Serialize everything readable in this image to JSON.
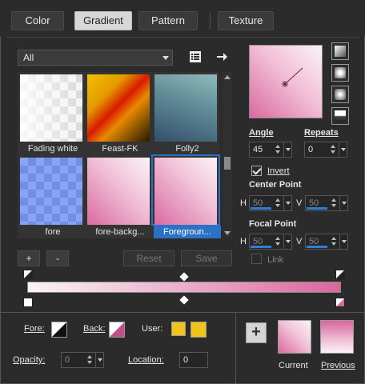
{
  "tabs": [
    {
      "label": "Color",
      "active": false
    },
    {
      "label": "Gradient",
      "active": true
    },
    {
      "label": "Pattern",
      "active": false
    },
    {
      "label": "Texture",
      "active": false
    }
  ],
  "category_select": {
    "value": "All"
  },
  "library": {
    "items": [
      {
        "label": "Fading white",
        "selected": false
      },
      {
        "label": "Feast-FK",
        "selected": false
      },
      {
        "label": "Folly2",
        "selected": false
      },
      {
        "label": "fore",
        "selected": false
      },
      {
        "label": "fore-backg...",
        "selected": false
      },
      {
        "label": "Foregroun...",
        "selected": true
      }
    ]
  },
  "buttons": {
    "add": "+",
    "remove": "-",
    "reset": "Reset",
    "save": "Save"
  },
  "angle": {
    "label": "Angle",
    "value": "45"
  },
  "repeats": {
    "label": "Repeats",
    "value": "0"
  },
  "invert": {
    "label": "Invert",
    "checked": true
  },
  "center_point": {
    "label": "Center Point",
    "h_label": "H",
    "h_value": "50",
    "v_label": "V",
    "v_value": "50"
  },
  "focal_point": {
    "label": "Focal Point",
    "h_label": "H",
    "h_value": "50",
    "v_label": "V",
    "v_value": "50"
  },
  "link": {
    "label": "Link",
    "checked": false
  },
  "gradient_colors": {
    "start": "#fbf5f8",
    "end": "#d9679e"
  },
  "fore": {
    "label": "Fore:"
  },
  "back": {
    "label": "Back:"
  },
  "user": {
    "label": "User:",
    "color_1": "#f0c419",
    "color_2": "#f0c419"
  },
  "opacity": {
    "label": "Opacity:",
    "value": "0"
  },
  "location": {
    "label": "Location:",
    "value": "0"
  },
  "current": {
    "label": "Current"
  },
  "previous": {
    "label": "Previous"
  },
  "icons": {
    "list_view": "list-icon",
    "next": "arrow-right-icon",
    "add_swatch": "plus-icon"
  }
}
